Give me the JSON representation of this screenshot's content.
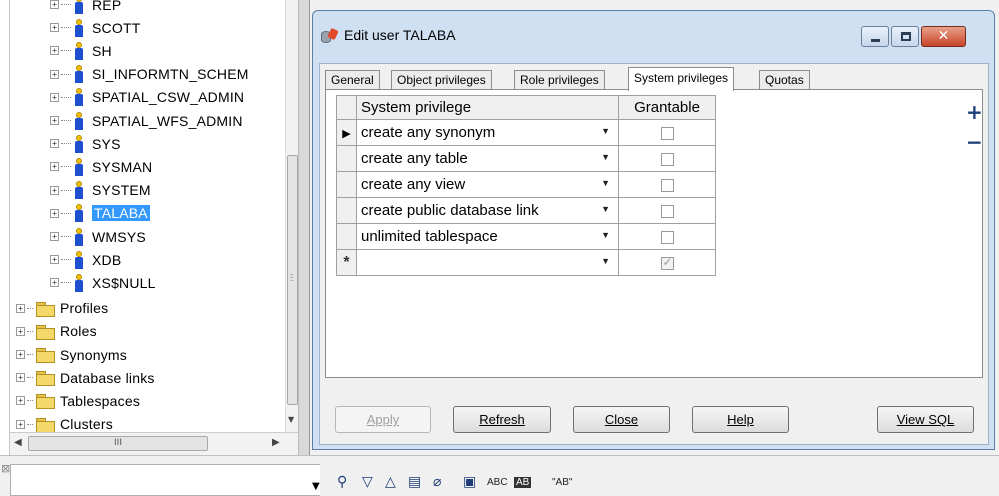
{
  "tree": {
    "users": [
      {
        "label": "REP"
      },
      {
        "label": "SCOTT"
      },
      {
        "label": "SH"
      },
      {
        "label": "SI_INFORMTN_SCHEM"
      },
      {
        "label": "SPATIAL_CSW_ADMIN"
      },
      {
        "label": "SPATIAL_WFS_ADMIN"
      },
      {
        "label": "SYS"
      },
      {
        "label": "SYSMAN"
      },
      {
        "label": "SYSTEM"
      },
      {
        "label": "TALABA",
        "selected": true
      },
      {
        "label": "WMSYS"
      },
      {
        "label": "XDB"
      },
      {
        "label": "XS$NULL"
      }
    ],
    "folders": [
      {
        "label": "Profiles"
      },
      {
        "label": "Roles"
      },
      {
        "label": "Synonyms"
      },
      {
        "label": "Database links"
      },
      {
        "label": "Tablespaces"
      },
      {
        "label": "Clusters"
      }
    ],
    "expander_glyph": "+",
    "hscroll_thumb_glyph": "III"
  },
  "dialog": {
    "title": "Edit user TALABA",
    "close_glyph": "✕",
    "tabs": [
      {
        "label": "General"
      },
      {
        "label": "Object privileges"
      },
      {
        "label": "Role privileges"
      },
      {
        "label": "System privileges",
        "active": true
      },
      {
        "label": "Quotas"
      }
    ],
    "grid": {
      "columns": [
        "System privilege",
        "Grantable"
      ],
      "rows": [
        {
          "privilege": "create any synonym",
          "grantable": false,
          "current": true
        },
        {
          "privilege": "create any table",
          "grantable": false
        },
        {
          "privilege": "create any view",
          "grantable": false
        },
        {
          "privilege": "create public database link",
          "grantable": false
        },
        {
          "privilege": "unlimited tablespace",
          "grantable": false
        }
      ],
      "new_row": {
        "privilege": "",
        "grantable": true
      },
      "current_row_glyph": "▶",
      "new_row_glyph": "*",
      "dropdown_glyph": "▼"
    },
    "add_glyph": "+",
    "remove_glyph": "−",
    "buttons": {
      "apply": "Apply",
      "refresh": "Refresh",
      "close": "Close",
      "help": "Help",
      "view_sql": "View SQL"
    }
  },
  "findbar": {
    "value": "",
    "icons": [
      "binoculars-icon",
      "find-next-icon",
      "find-previous-icon",
      "highlight-all-icon",
      "clear-icon",
      "options-icon"
    ],
    "match_case_label": "ABC",
    "whole_word_label": "AB",
    "quote_label": "\"AB\""
  }
}
